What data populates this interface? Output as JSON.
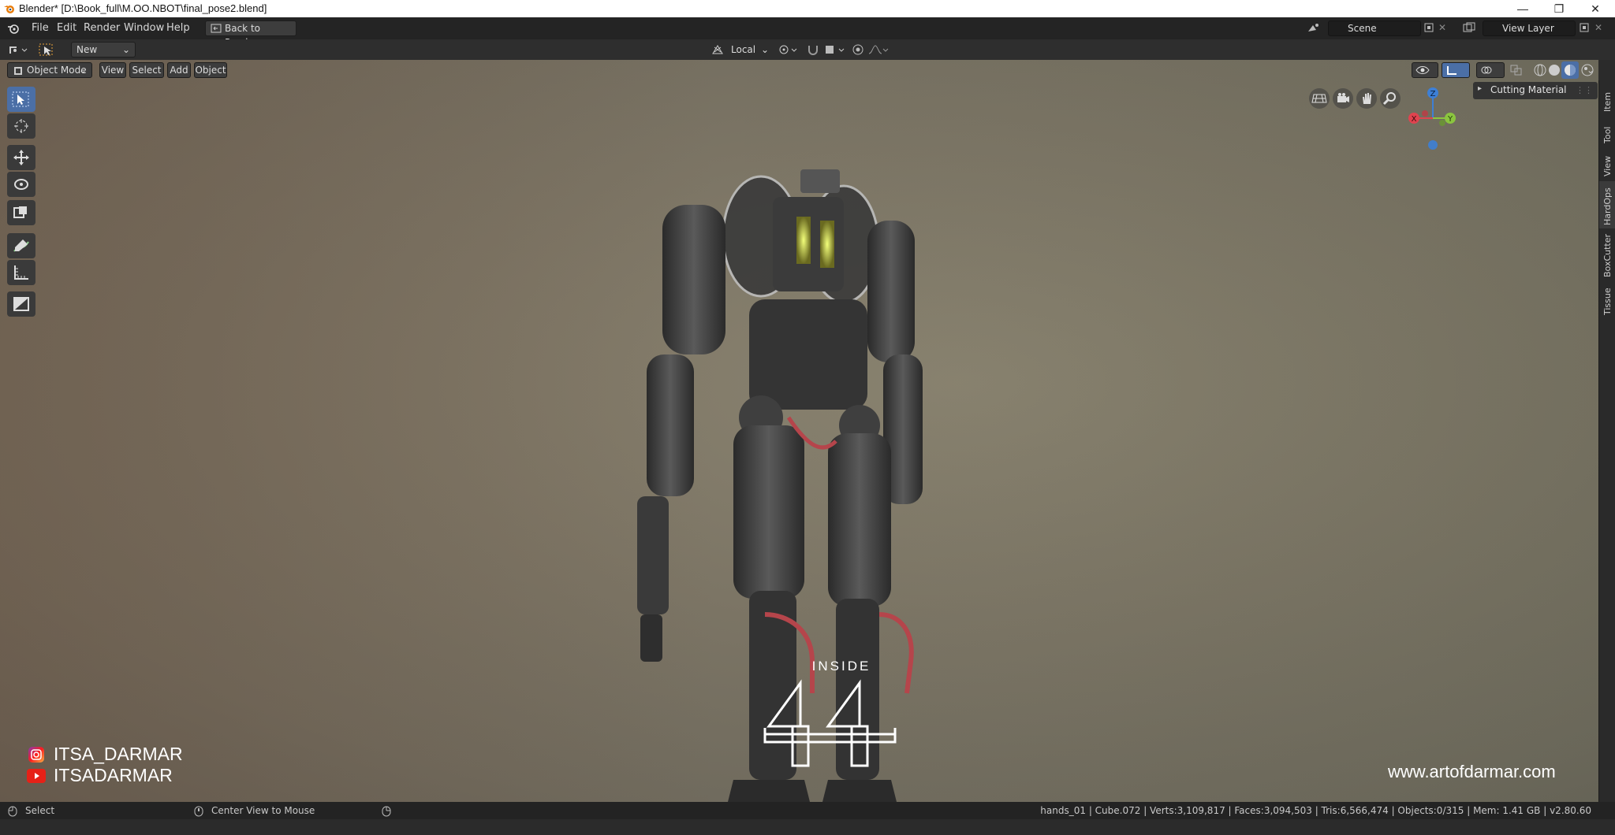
{
  "window": {
    "title": "Blender* [D:\\Book_full\\M.OO.NBOT\\final_pose2.blend]"
  },
  "menu": {
    "file": "File",
    "edit": "Edit",
    "render": "Render",
    "window": "Window",
    "help": "Help",
    "back_to_previous": "Back to Previous",
    "scene": "Scene",
    "view_layer": "View Layer"
  },
  "toolheader": {
    "brush_preset": "New",
    "orientation": "Local"
  },
  "viewheader": {
    "mode": "Object Mode",
    "view": "View",
    "select": "Select",
    "add": "Add",
    "object": "Object"
  },
  "sidebar": {
    "tabs": [
      "Item",
      "Tool",
      "View",
      "HardOps",
      "BoxCutter",
      "Tissue"
    ],
    "active_tab": "HardOps",
    "panel_label": "Cutting Material"
  },
  "gizmo": {
    "z": "Z",
    "x": "X",
    "y": "Y"
  },
  "overlay": {
    "instagram": "ITSA_DARMAR",
    "youtube": "ITSADARMAR",
    "inside_label": "INSIDE",
    "logo_number": "44",
    "website": "www.artofdarmar.com"
  },
  "statusbar": {
    "left_action": "Select",
    "middle_action": "Center View to Mouse",
    "stats": "hands_01 | Cube.072 | Verts:3,109,817 | Faces:3,094,503 | Tris:6,566,474 | Objects:0/315 | Mem: 1.41 GB | v2.80.60"
  },
  "colors": {
    "accent": "#4b6fa6",
    "axis_x": "#e0434f",
    "axis_y": "#8bc53f",
    "axis_z": "#3d7fd6"
  }
}
